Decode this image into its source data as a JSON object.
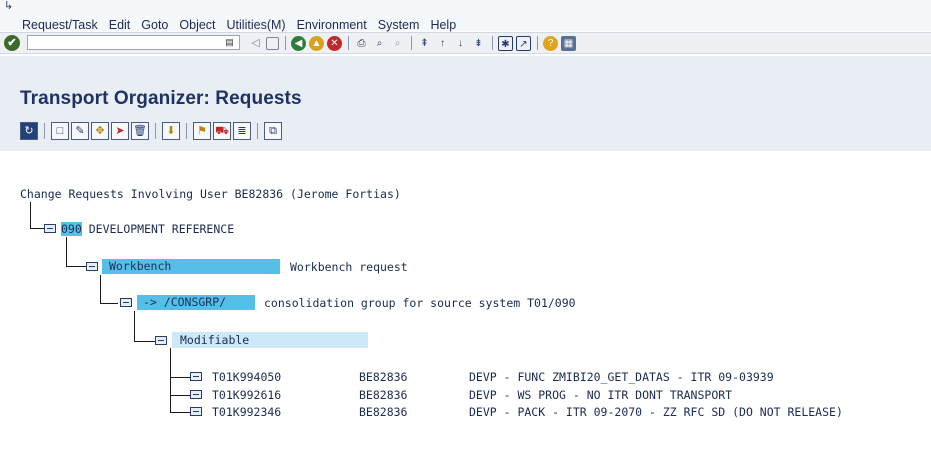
{
  "menubar": {
    "items": [
      "Request/Task",
      "Edit",
      "Goto",
      "Object",
      "Utilities(M)",
      "Environment",
      "System",
      "Help"
    ]
  },
  "toolbar": {
    "command_value": "",
    "icons": [
      "enter-icon",
      "back-icon",
      "save-icon",
      "back-nav-icon",
      "exit-icon",
      "cancel-icon",
      "print-icon",
      "find-icon",
      "find-next-icon",
      "first-page-icon",
      "prev-page-icon",
      "next-page-icon",
      "last-page-icon",
      "create-session-icon",
      "shortcut-icon",
      "help-icon",
      "layout-icon"
    ]
  },
  "page": {
    "title": "Transport Organizer: Requests"
  },
  "app_toolbar": {
    "icons": [
      "refresh-icon",
      "create-icon",
      "change-icon",
      "move-icon",
      "release-icon",
      "delete-icon",
      "sort-icon",
      "transport-icon",
      "truck-icon",
      "display-object-list-icon",
      "where-used-icon"
    ]
  },
  "tree": {
    "root_label": "Change Requests Involving User BE82836 (Jerome Fortias)",
    "client": {
      "code": "090",
      "label": "DEVELOPMENT REFERENCE"
    },
    "workbench": {
      "label": "Workbench",
      "description": "Workbench request"
    },
    "group": {
      "label": "-> /CONSGRP/",
      "description": "consolidation group for source system T01/090"
    },
    "status": {
      "label": "Modifiable"
    },
    "requests": [
      {
        "id": "T01K994050",
        "owner": "BE82836",
        "description": "DEVP - FUNC ZMIBI20_GET_DATAS - ITR 09-03939"
      },
      {
        "id": "T01K992616",
        "owner": "BE82836",
        "description": "DEVP - WS PROG - NO ITR DONT TRANSPORT"
      },
      {
        "id": "T01K992346",
        "owner": "BE82836",
        "description": "DEVP - PACK - ITR 09-2070 - ZZ RFC SD (DO NOT RELEASE)"
      }
    ]
  }
}
